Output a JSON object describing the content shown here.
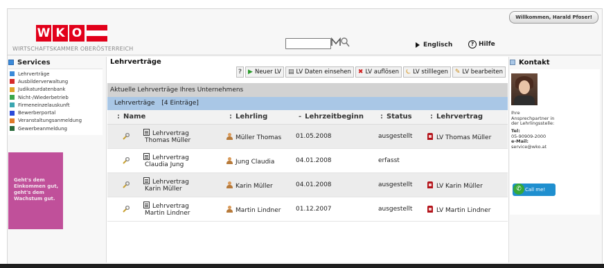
{
  "header": {
    "welcome": "Willkommen, Harald Pfoser!",
    "logo_letters": [
      "W",
      "K",
      "O"
    ],
    "brand_sub": "WIRTSCHAFTSKAMMER OBERÖSTERREICH",
    "search_value": "",
    "lang": "Englisch",
    "help": "Hilfe",
    "help_glyph": "?"
  },
  "sidebar": {
    "title": "Services",
    "items": [
      {
        "label": "Lehrverträge",
        "color": "#3b8ad9"
      },
      {
        "label": "Ausbilderverwaltung",
        "color": "#d62a2a"
      },
      {
        "label": "Judikaturdatenbank",
        "color": "#e0a42a"
      },
      {
        "label": "Nicht-/Wiederbetrieb",
        "color": "#3aa64a"
      },
      {
        "label": "Firmeneinzelauskunft",
        "color": "#3aa6b0"
      },
      {
        "label": "Bewerberportal",
        "color": "#2a4ad9"
      },
      {
        "label": "Veranstaltungsanmeldung",
        "color": "#e07a2a"
      },
      {
        "label": "Gewerbeanmeldung",
        "color": "#2a6a3a"
      }
    ],
    "promo": [
      "Geht's dem",
      "Einkommen gut,",
      "geht's dem",
      "Wachstum gut."
    ]
  },
  "main": {
    "title": "Lehrverträge",
    "toolbar": [
      {
        "label": "Neuer LV",
        "icon": "play-icon",
        "glyph": "▶",
        "color": "#2a9a2a"
      },
      {
        "label": "LV Daten einsehen",
        "icon": "book-icon",
        "glyph": "▤",
        "color": "#444"
      },
      {
        "label": "LV auflösen",
        "icon": "x-icon",
        "glyph": "✖",
        "color": "#d21a1a"
      },
      {
        "label": "LV stilllegen",
        "icon": "pause-icon",
        "glyph": "⏾",
        "color": "#d89a2a"
      },
      {
        "label": "LV bearbeiten",
        "icon": "edit-icon",
        "glyph": "✎",
        "color": "#c88a1a"
      }
    ],
    "section_title": "Aktuelle Lehrverträge Ihres Unternehmens",
    "count_label": "Lehrverträge",
    "count_value": "[4 Einträge]",
    "columns": {
      "name": "Name",
      "lehrling": "Lehrling",
      "beginn": "Lehrzeitbeginn",
      "status": "Status",
      "lehrvertrag": "Lehrvertrag"
    },
    "rows": [
      {
        "doc": "Lehrvertrag",
        "person": "Thomas Müller",
        "lehrling": "Müller Thomas",
        "beginn": "01.05.2008",
        "status": "ausgestellt",
        "lv": "LV Thomas Müller"
      },
      {
        "doc": "Lehrvertrag",
        "person": "Claudia Jung",
        "lehrling": "Jung Claudia",
        "beginn": "04.01.2008",
        "status": "erfasst",
        "lv": ""
      },
      {
        "doc": "Lehrvertrag",
        "person": "Karin Müller",
        "lehrling": "Karin Müller",
        "beginn": "04.01.2008",
        "status": "ausgestellt",
        "lv": "LV Karin Müller"
      },
      {
        "doc": "Lehrvertrag",
        "person": "Martin Lindner",
        "lehrling": "Martin Lindner",
        "beginn": "01.12.2007",
        "status": "ausgestellt",
        "lv": "LV Martin Lindner"
      }
    ]
  },
  "contact": {
    "title": "Kontakt",
    "line1": "Ihre",
    "line2": "Ansprechpartner in",
    "line3": "der Lehrlingsstelle:",
    "tel_label": "Tel:",
    "tel": "05-90909-2000",
    "mail_label": "e-Mail:",
    "mail": "service@wko.at",
    "call": "Call me!"
  },
  "colors": {
    "brand_red": "#e2001a",
    "count_bar": "#a9c7e6",
    "promo": "#c0509a"
  }
}
